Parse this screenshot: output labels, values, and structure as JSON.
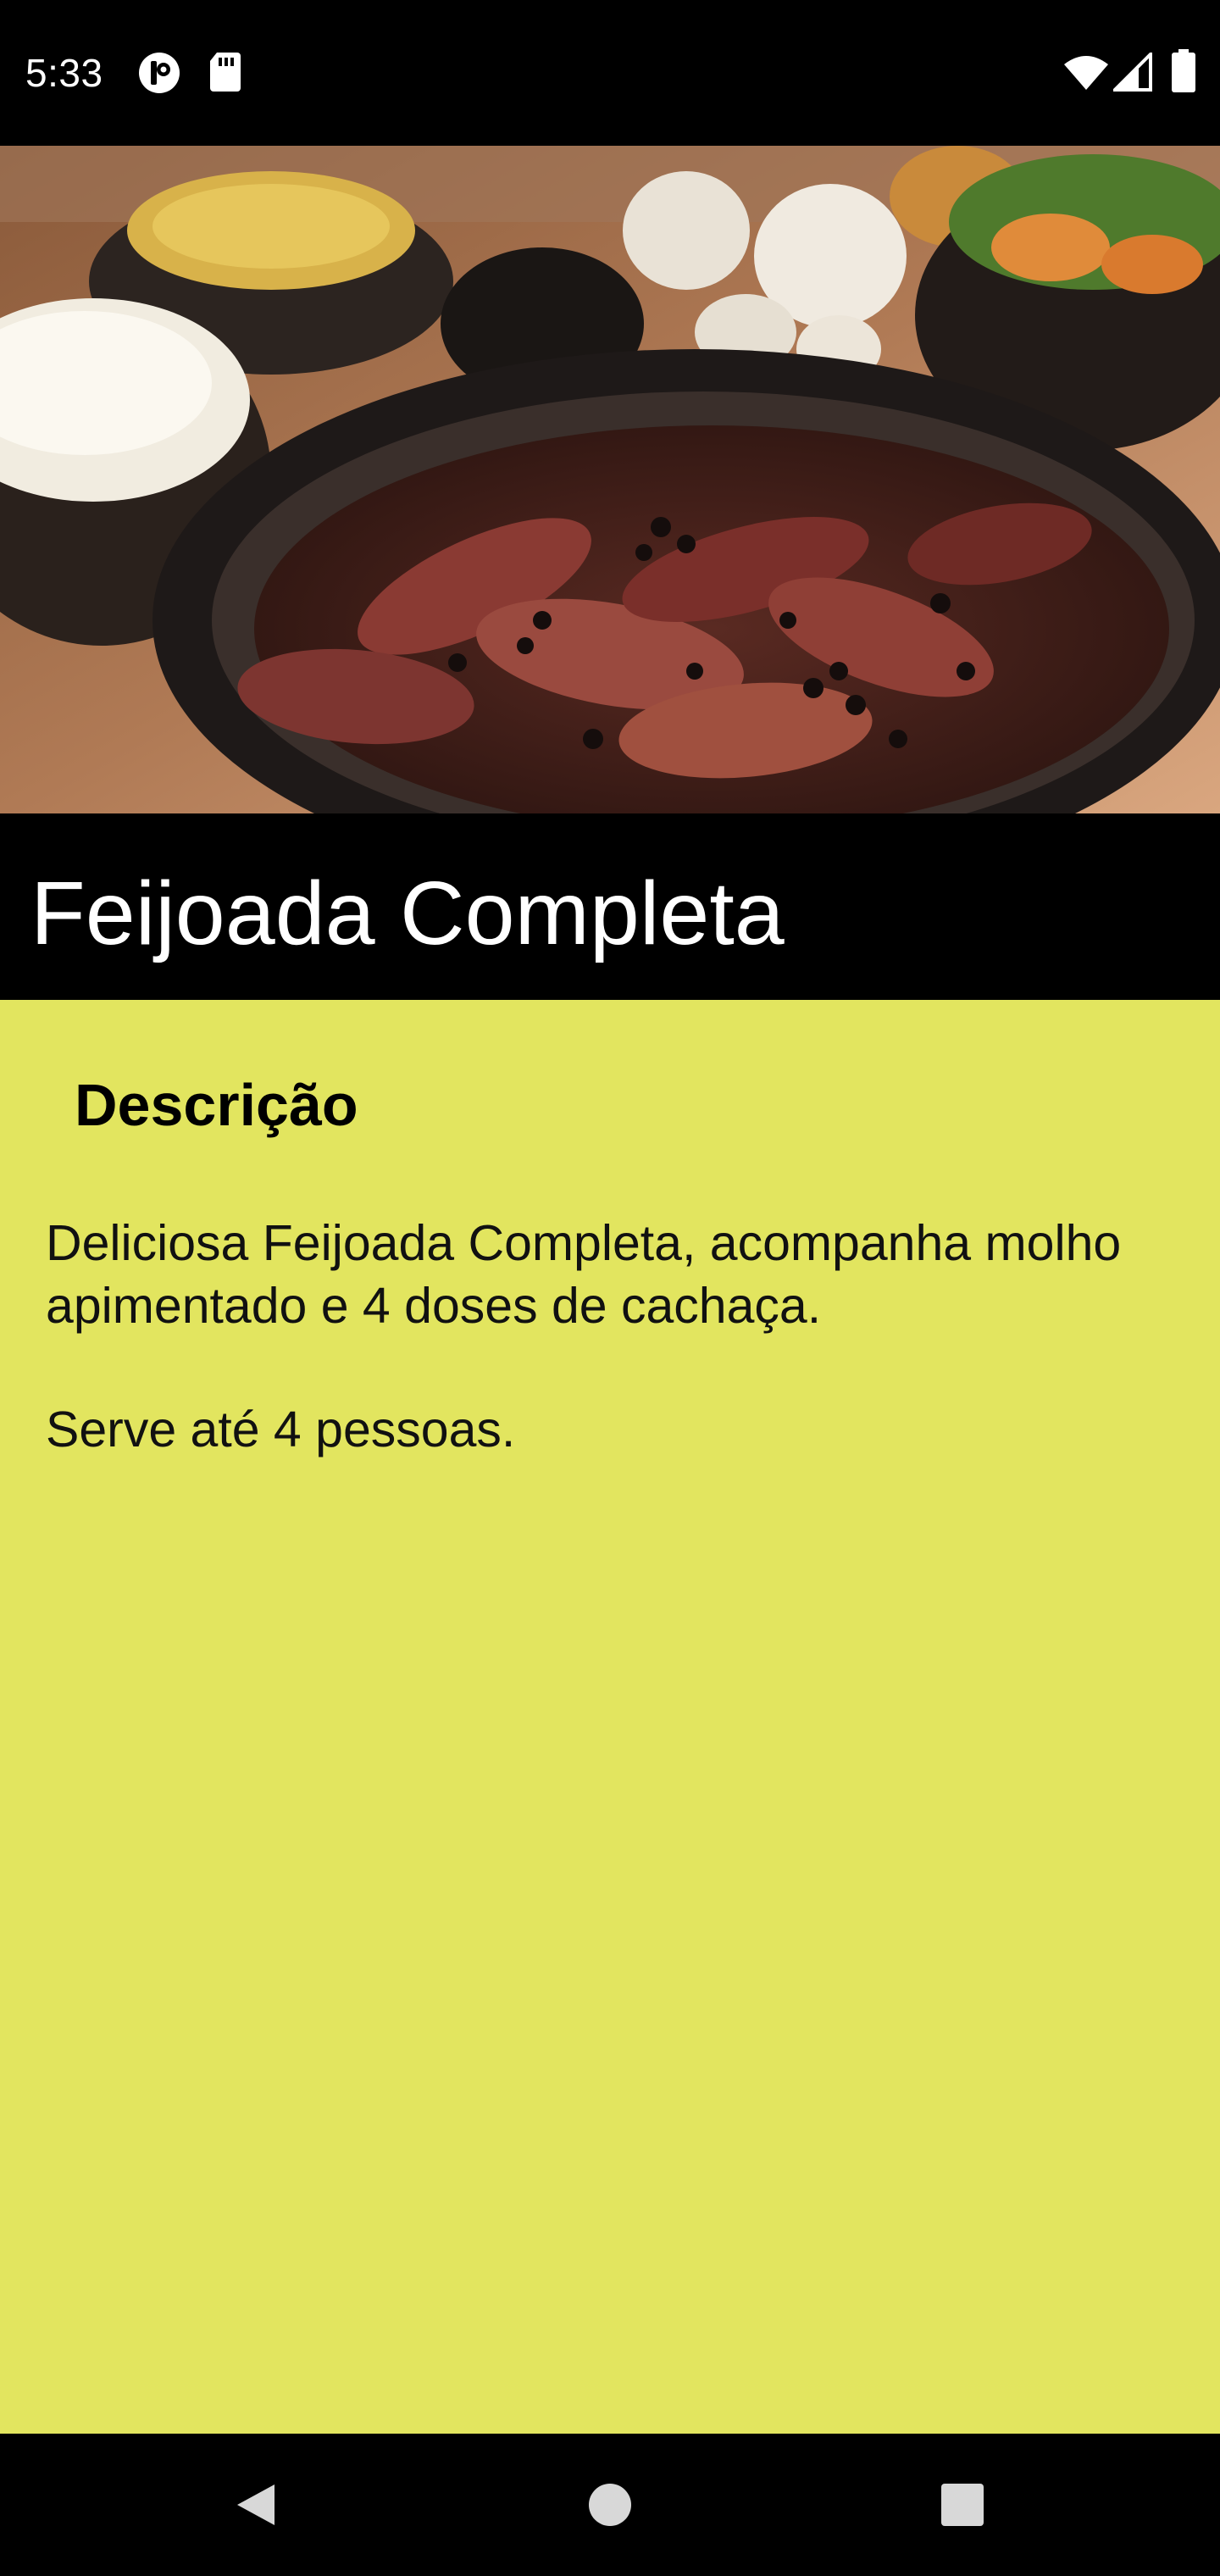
{
  "status_bar": {
    "time": "5:33",
    "left_icons": [
      "notification-app-icon",
      "sd-card-icon"
    ],
    "right_icons": [
      "wifi-icon",
      "cell-signal-icon",
      "battery-icon"
    ]
  },
  "hero": {
    "image": "feijoada-dish-photo"
  },
  "title": "Feijoada Completa",
  "content": {
    "background_color": "#e2e55f",
    "heading": "Descrição",
    "description_line1": "Deliciosa Feijoada Completa, acompanha molho apimentado e 4 doses de cachaça.",
    "description_line2": "Serve até 4 pessoas."
  },
  "nav_bar": {
    "buttons": [
      "back-icon",
      "home-icon",
      "recents-icon"
    ]
  }
}
